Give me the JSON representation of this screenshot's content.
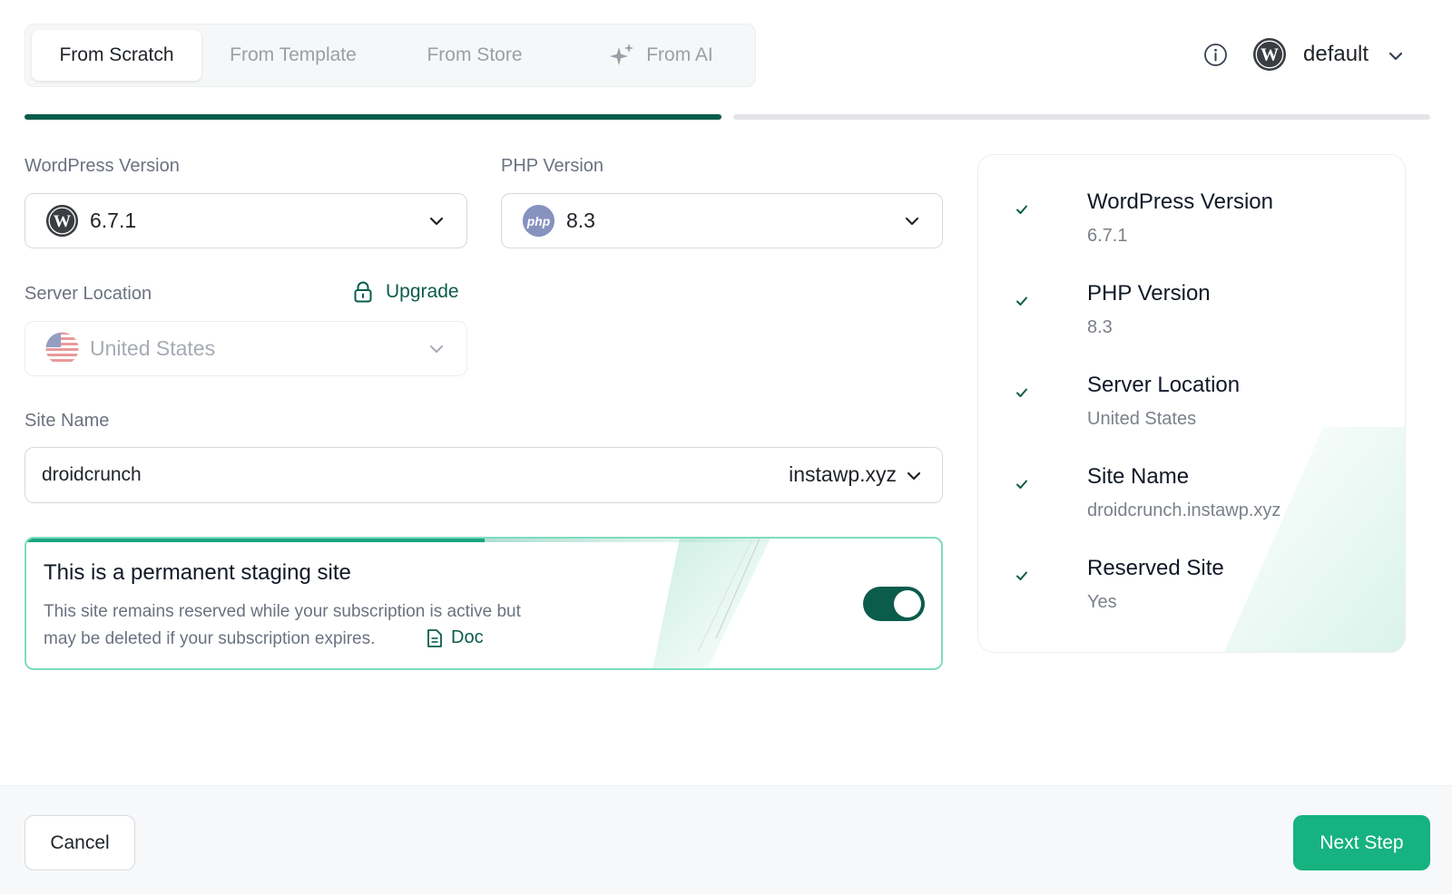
{
  "colors": {
    "accent_dark": "#0b5c4b",
    "accent_green": "#16b27f",
    "progress_active": "#0b5c4b",
    "progress_inactive": "#e3e5e8",
    "php_purple": "#8892bf"
  },
  "tabs": [
    {
      "label": "From Scratch",
      "active": true
    },
    {
      "label": "From Template",
      "active": false
    },
    {
      "label": "From Store",
      "active": false
    },
    {
      "label": "From AI",
      "active": false,
      "icon": "sparkles-icon"
    }
  ],
  "header": {
    "account_name": "default",
    "info_icon": "info-icon",
    "account_icon": "wordpress-logo-icon"
  },
  "progress": {
    "step": 1,
    "total_steps": 2
  },
  "form": {
    "wp_version": {
      "label": "WordPress Version",
      "value": "6.7.1",
      "icon": "wordpress-logo-icon"
    },
    "php_version": {
      "label": "PHP Version",
      "value": "8.3",
      "icon": "php-logo-icon",
      "icon_text": "php"
    },
    "server_location": {
      "label": "Server Location",
      "value": "United States",
      "icon": "us-flag-icon",
      "disabled": true,
      "upgrade_label": "Upgrade"
    },
    "site_name": {
      "label": "Site Name",
      "value": "droidcrunch",
      "domain": "instawp.xyz"
    }
  },
  "staging": {
    "title": "This is a permanent staging site",
    "description_line1": "This site remains reserved while your subscription is active but",
    "description_line2": "may be deleted if your subscription expires.",
    "doc_label": "Doc",
    "enabled": true
  },
  "summary": [
    {
      "label": "WordPress Version",
      "value": "6.7.1"
    },
    {
      "label": "PHP Version",
      "value": "8.3"
    },
    {
      "label": "Server Location",
      "value": "United States"
    },
    {
      "label": "Site Name",
      "value": "droidcrunch.instawp.xyz"
    },
    {
      "label": "Reserved Site",
      "value": "Yes"
    }
  ],
  "footer": {
    "cancel_label": "Cancel",
    "next_label": "Next Step"
  }
}
